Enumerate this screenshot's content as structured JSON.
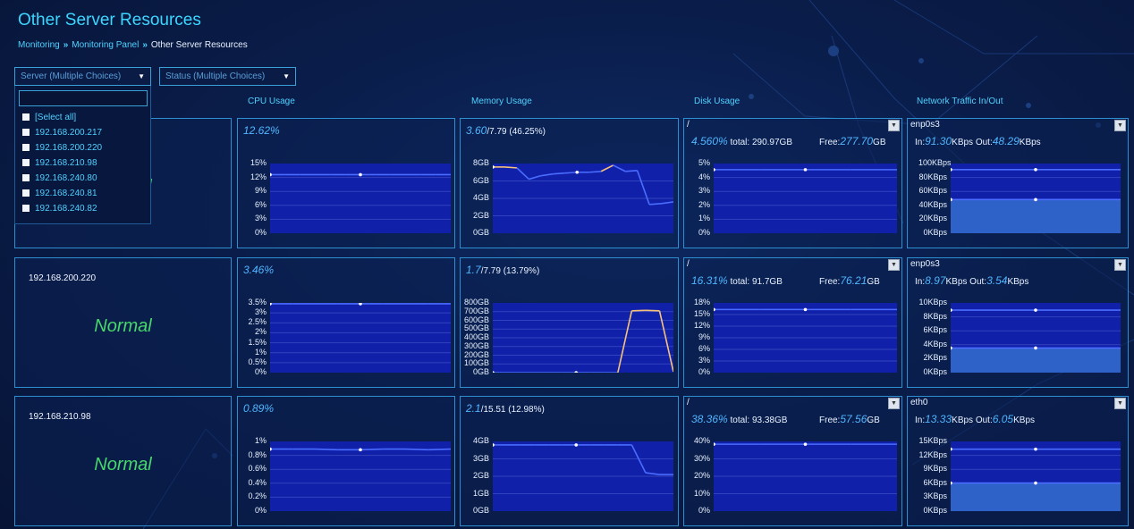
{
  "page": {
    "title": "Other Server Resources",
    "breadcrumb": [
      "Monitoring",
      "Monitoring Panel",
      "Other Server Resources"
    ]
  },
  "filters": {
    "server_placeholder": "Server (Multiple Choices)",
    "status_placeholder": "Status (Multiple Choices)",
    "server_options": [
      "[Select all]",
      "192.168.200.217",
      "192.168.200.220",
      "192.168.210.98",
      "192.168.240.80",
      "192.168.240.81",
      "192.168.240.82"
    ]
  },
  "columns": [
    "CPU Usage",
    "Memory Usage",
    "Disk Usage",
    "Network Traffic In/Out"
  ],
  "colors": {
    "accent": "#3cd6ff",
    "normal": "#47d86b",
    "plot_bg": "#1020a8",
    "line": "#4a6cff",
    "memory_spike": "#f6c27a"
  },
  "servers": [
    {
      "ip": "",
      "status": "Normal",
      "cpu": {
        "value": "12.62%",
        "ticks": [
          "15%",
          "12%",
          "9%",
          "6%",
          "3%",
          "0%"
        ],
        "max": 15,
        "series": [
          12.6,
          12.6,
          12.6,
          12.6,
          12.6,
          12.6,
          12.6,
          12.6,
          12.6,
          12.6,
          12.6,
          12.6,
          12.6
        ]
      },
      "memory": {
        "value": "3.60",
        "detail": "/7.79 (46.25%)",
        "ticks": [
          "8GB",
          "6GB",
          "4GB",
          "2GB",
          "0GB"
        ],
        "max": 8,
        "series": [
          7.6,
          7.6,
          7.5,
          6.2,
          6.6,
          6.8,
          6.9,
          7.0,
          7.0,
          7.1,
          7.8,
          7.1,
          7.2,
          3.3,
          3.4,
          3.6
        ]
      },
      "disk": {
        "mount": "/",
        "percent": "4.560%",
        "total_label": "total:",
        "total": "290.97GB",
        "free_label": "Free:",
        "free": "277.70",
        "free_unit": "GB",
        "ticks": [
          "5%",
          "4%",
          "3%",
          "2%",
          "1%",
          "0%"
        ],
        "max": 5,
        "series": [
          4.56,
          4.56,
          4.56,
          4.56,
          4.56
        ]
      },
      "network": {
        "iface": "enp0s3",
        "in_label": "In:",
        "in": "91.30",
        "unit": "KBps",
        "out_label": "Out:",
        "out": "48.29",
        "ticks": [
          "100KBps",
          "80KBps",
          "60KBps",
          "40KBps",
          "20KBps",
          "0KBps"
        ],
        "max": 100,
        "series_in": [
          91.3,
          91.3,
          91.3
        ],
        "series_out": [
          48.3,
          48.3,
          48.3
        ]
      }
    },
    {
      "ip": "192.168.200.220",
      "status": "Normal",
      "cpu": {
        "value": "3.46%",
        "ticks": [
          "3.5%",
          "3%",
          "2.5%",
          "2%",
          "1.5%",
          "1%",
          "0.5%",
          "0%"
        ],
        "max": 3.5,
        "series": [
          3.46,
          3.46,
          3.46,
          3.46,
          3.46,
          3.46,
          3.46,
          3.46,
          3.46
        ]
      },
      "memory": {
        "value": "1.7",
        "detail": "/7.79 (13.79%)",
        "ticks": [
          "800GB",
          "700GB",
          "600GB",
          "500GB",
          "400GB",
          "300GB",
          "200GB",
          "100GB",
          "0GB"
        ],
        "max": 800,
        "series": [
          0,
          0,
          0,
          0,
          0,
          0,
          0,
          0,
          0,
          0,
          710,
          715,
          710,
          10
        ]
      },
      "disk": {
        "mount": "/",
        "percent": "16.31%",
        "total_label": "total:",
        "total": "91.7GB",
        "free_label": "Free:",
        "free": "76.21",
        "free_unit": "GB",
        "ticks": [
          "18%",
          "15%",
          "12%",
          "9%",
          "6%",
          "3%",
          "0%"
        ],
        "max": 18,
        "series": [
          16.3,
          16.3,
          16.3,
          16.3,
          16.3
        ]
      },
      "network": {
        "iface": "enp0s3",
        "in_label": "In:",
        "in": "8.97",
        "unit": "KBps",
        "out_label": "Out:",
        "out": "3.54",
        "ticks": [
          "10KBps",
          "8KBps",
          "6KBps",
          "4KBps",
          "2KBps",
          "0KBps"
        ],
        "max": 10,
        "series_in": [
          8.97,
          8.97,
          8.97
        ],
        "series_out": [
          3.54,
          3.54,
          3.54
        ]
      }
    },
    {
      "ip": "192.168.210.98",
      "status": "Normal",
      "cpu": {
        "value": "0.89%",
        "ticks": [
          "1%",
          "0.8%",
          "0.6%",
          "0.4%",
          "0.2%",
          "0%"
        ],
        "max": 1,
        "series": [
          0.89,
          0.89,
          0.89,
          0.88,
          0.88,
          0.89,
          0.89,
          0.88,
          0.89
        ]
      },
      "memory": {
        "value": "2.1",
        "detail": "/15.51 (12.98%)",
        "ticks": [
          "4GB",
          "3GB",
          "2GB",
          "1GB",
          "0GB"
        ],
        "max": 4,
        "series": [
          3.8,
          3.8,
          3.8,
          3.8,
          3.8,
          3.8,
          3.8,
          3.8,
          3.8,
          3.8,
          3.8,
          2.2,
          2.1,
          2.1
        ]
      },
      "disk": {
        "mount": "/",
        "percent": "38.36%",
        "total_label": "total:",
        "total": "93.38GB",
        "free_label": "Free:",
        "free": "57.56",
        "free_unit": "GB",
        "ticks": [
          "40%",
          "30%",
          "20%",
          "10%",
          "0%"
        ],
        "max": 40,
        "series": [
          38.4,
          38.4,
          38.4,
          38.4,
          38.4
        ]
      },
      "network": {
        "iface": "eth0",
        "in_label": "In:",
        "in": "13.33",
        "unit": "KBps",
        "out_label": "Out:",
        "out": "6.05",
        "ticks": [
          "15KBps",
          "12KBps",
          "9KBps",
          "6KBps",
          "3KBps",
          "0KBps"
        ],
        "max": 15,
        "series_in": [
          13.33,
          13.33,
          13.33
        ],
        "series_out": [
          6.05,
          6.05,
          6.05
        ]
      }
    }
  ]
}
